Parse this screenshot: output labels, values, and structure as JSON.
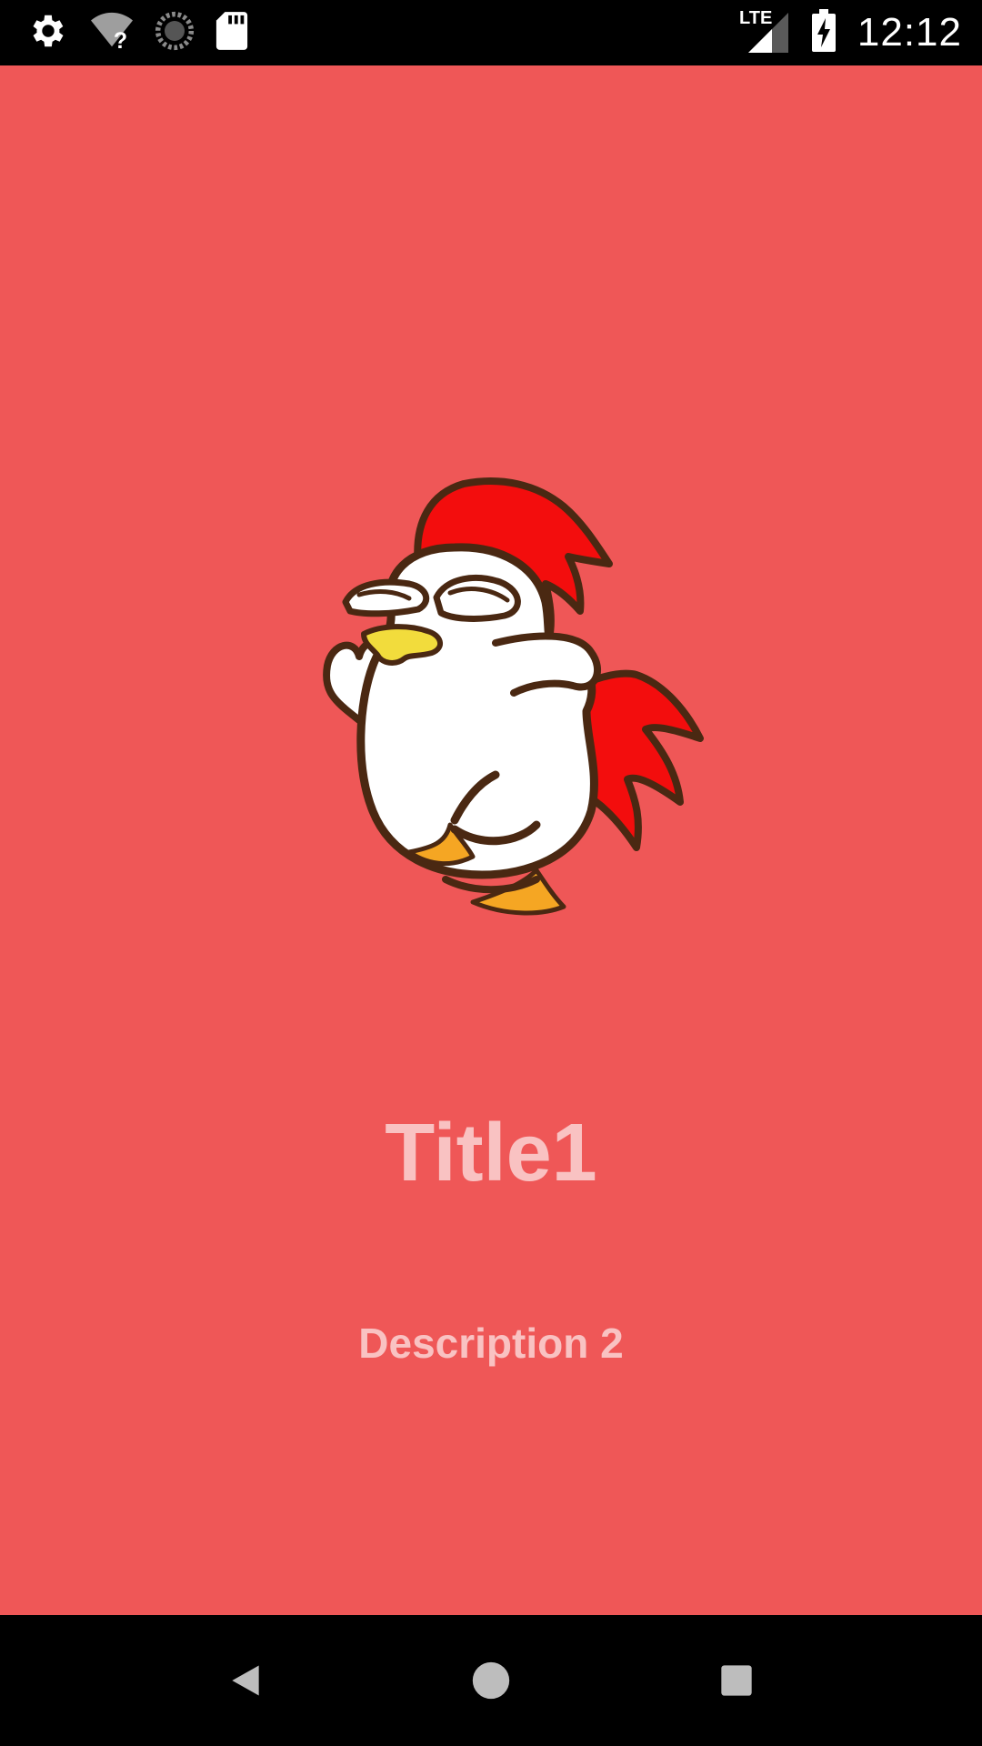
{
  "status_bar": {
    "time": "12:12",
    "network_label": "LTE",
    "icons": [
      "settings-icon",
      "wifi-unknown-icon",
      "sync-icon",
      "sd-card-icon",
      "lte-signal-icon",
      "battery-charging-icon"
    ]
  },
  "screen": {
    "title": "Title1",
    "description": "Description 2",
    "background_color": "#ef5757",
    "text_color": "#f9c2c2",
    "image": "rooster-mascot"
  },
  "nav_bar": {
    "buttons": [
      "back-icon",
      "home-icon",
      "recents-icon"
    ]
  }
}
